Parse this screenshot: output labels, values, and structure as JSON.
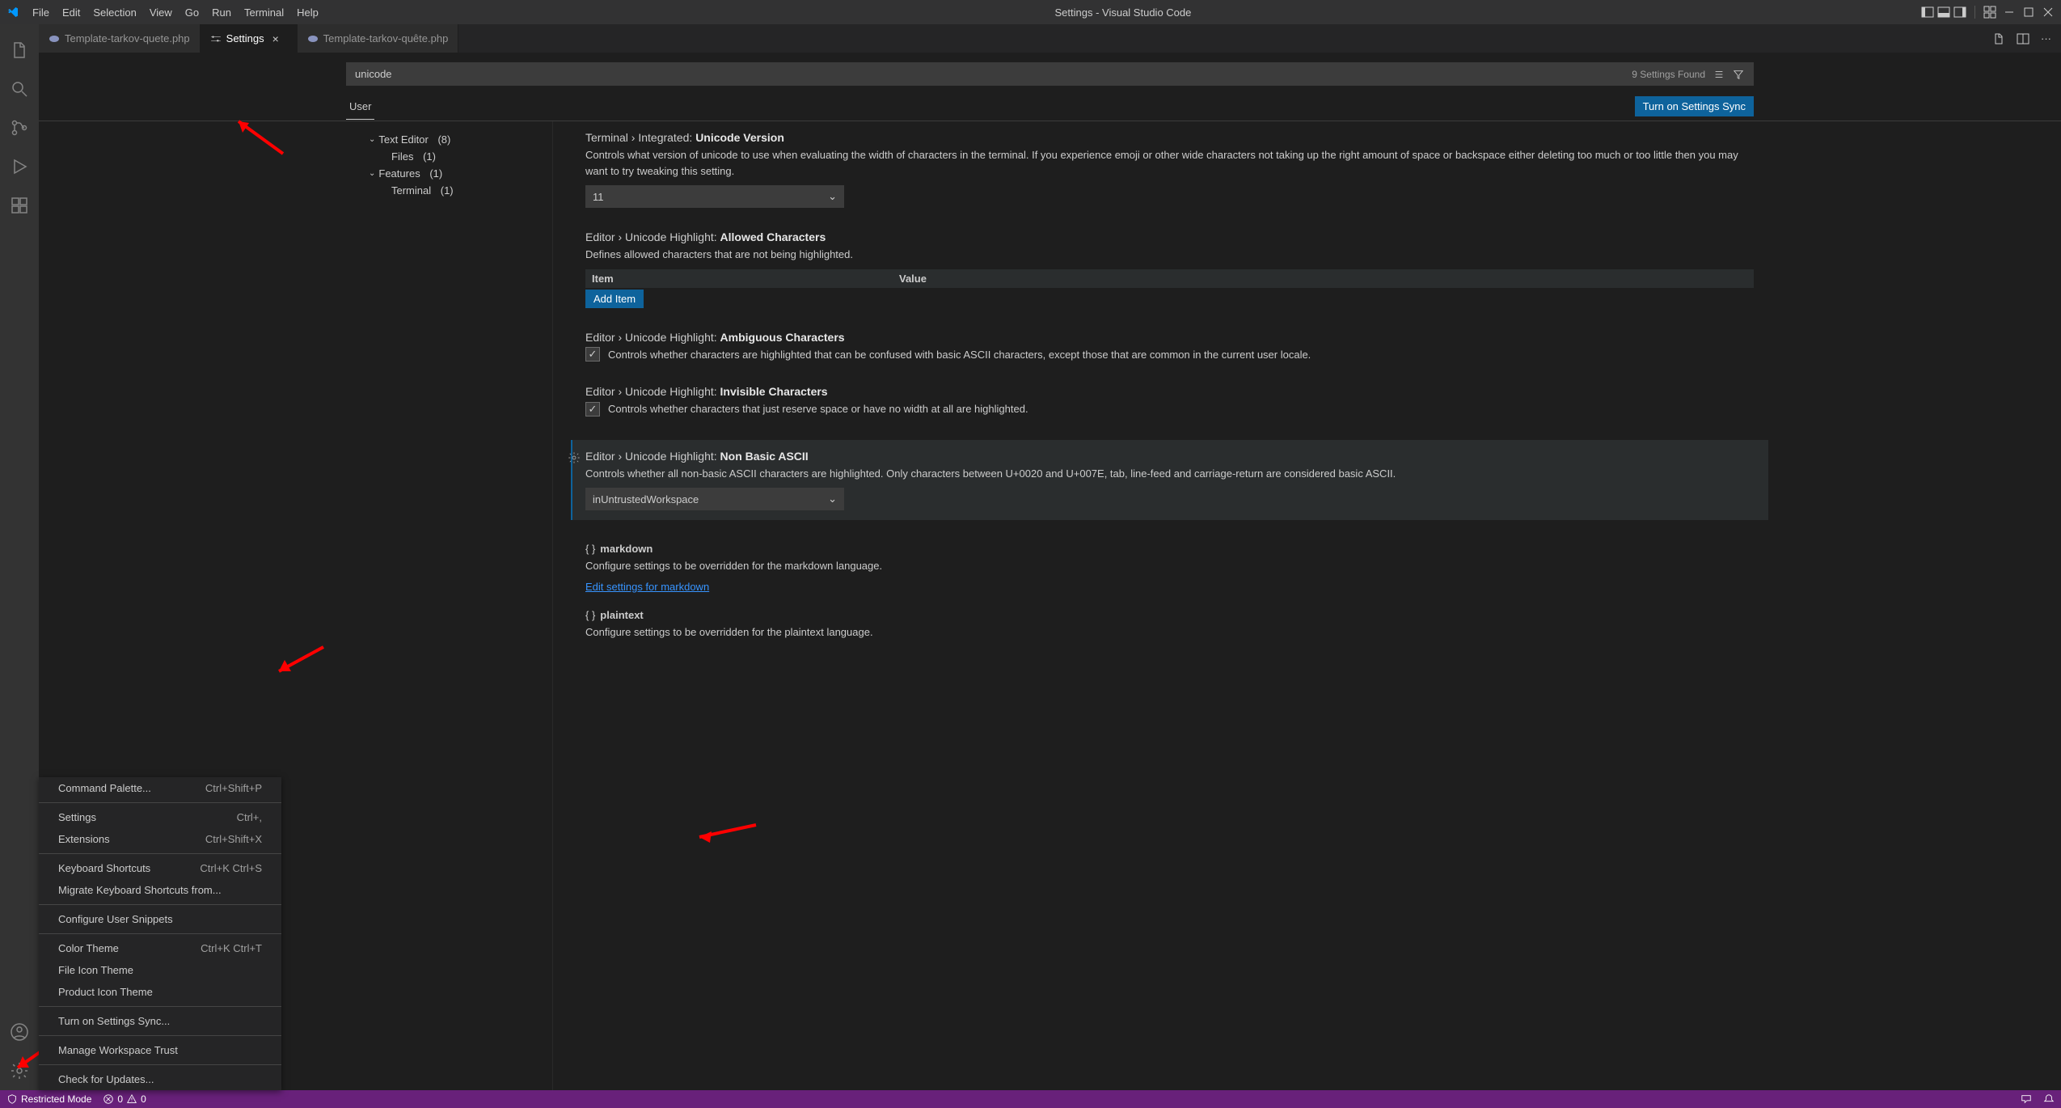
{
  "titlebar": {
    "menu": [
      "File",
      "Edit",
      "Selection",
      "View",
      "Go",
      "Run",
      "Terminal",
      "Help"
    ],
    "title": "Settings - Visual Studio Code"
  },
  "tabs": [
    {
      "label": "Template-tarkov-quete.php",
      "active": false,
      "icon": "php"
    },
    {
      "label": "Settings",
      "active": true,
      "icon": "settings"
    },
    {
      "label": "Template-tarkov-quête.php",
      "active": false,
      "icon": "php"
    }
  ],
  "settings": {
    "search_value": "unicode",
    "results_label": "9 Settings Found",
    "scope_tab": "User",
    "sync_button": "Turn on Settings Sync",
    "toc": {
      "text_editor": {
        "label": "Text Editor",
        "count": "(8)"
      },
      "files": {
        "label": "Files",
        "count": "(1)"
      },
      "features": {
        "label": "Features",
        "count": "(1)"
      },
      "terminal": {
        "label": "Terminal",
        "count": "(1)"
      }
    },
    "items": {
      "terminal_unicode": {
        "cat": "Terminal › Integrated:",
        "name": "Unicode Version",
        "desc": "Controls what version of unicode to use when evaluating the width of characters in the terminal. If you experience emoji or other wide characters not taking up the right amount of space or backspace either deleting too much or too little then you may want to try tweaking this setting.",
        "value": "11"
      },
      "allowed_chars": {
        "cat": "Editor › Unicode Highlight:",
        "name": "Allowed Characters",
        "desc": "Defines allowed characters that are not being highlighted.",
        "col_item": "Item",
        "col_value": "Value",
        "add_btn": "Add Item"
      },
      "ambiguous": {
        "cat": "Editor › Unicode Highlight:",
        "name": "Ambiguous Characters",
        "desc": "Controls whether characters are highlighted that can be confused with basic ASCII characters, except those that are common in the current user locale."
      },
      "invisible": {
        "cat": "Editor › Unicode Highlight:",
        "name": "Invisible Characters",
        "desc": "Controls whether characters that just reserve space or have no width at all are highlighted."
      },
      "non_basic": {
        "cat": "Editor › Unicode Highlight:",
        "name": "Non Basic ASCII",
        "desc": "Controls whether all non-basic ASCII characters are highlighted. Only characters between U+0020 and U+007E, tab, line-feed and carriage-return are considered basic ASCII.",
        "value": "inUntrustedWorkspace"
      },
      "markdown": {
        "label": "markdown",
        "desc": "Configure settings to be overridden for the markdown language.",
        "link": "Edit settings for markdown"
      },
      "plaintext": {
        "label": "plaintext",
        "desc": "Configure settings to be overridden for the plaintext language."
      }
    }
  },
  "context_menu": [
    {
      "label": "Command Palette...",
      "shortcut": "Ctrl+Shift+P"
    },
    {
      "sep": true
    },
    {
      "label": "Settings",
      "shortcut": "Ctrl+,"
    },
    {
      "label": "Extensions",
      "shortcut": "Ctrl+Shift+X"
    },
    {
      "sep": true
    },
    {
      "label": "Keyboard Shortcuts",
      "shortcut": "Ctrl+K Ctrl+S"
    },
    {
      "label": "Migrate Keyboard Shortcuts from..."
    },
    {
      "sep": true
    },
    {
      "label": "Configure User Snippets"
    },
    {
      "sep": true
    },
    {
      "label": "Color Theme",
      "shortcut": "Ctrl+K Ctrl+T"
    },
    {
      "label": "File Icon Theme"
    },
    {
      "label": "Product Icon Theme"
    },
    {
      "sep": true
    },
    {
      "label": "Turn on Settings Sync..."
    },
    {
      "sep": true
    },
    {
      "label": "Manage Workspace Trust"
    },
    {
      "sep": true
    },
    {
      "label": "Check for Updates..."
    }
  ],
  "statusbar": {
    "restricted": "Restricted Mode",
    "errors": "0",
    "warnings": "0"
  }
}
